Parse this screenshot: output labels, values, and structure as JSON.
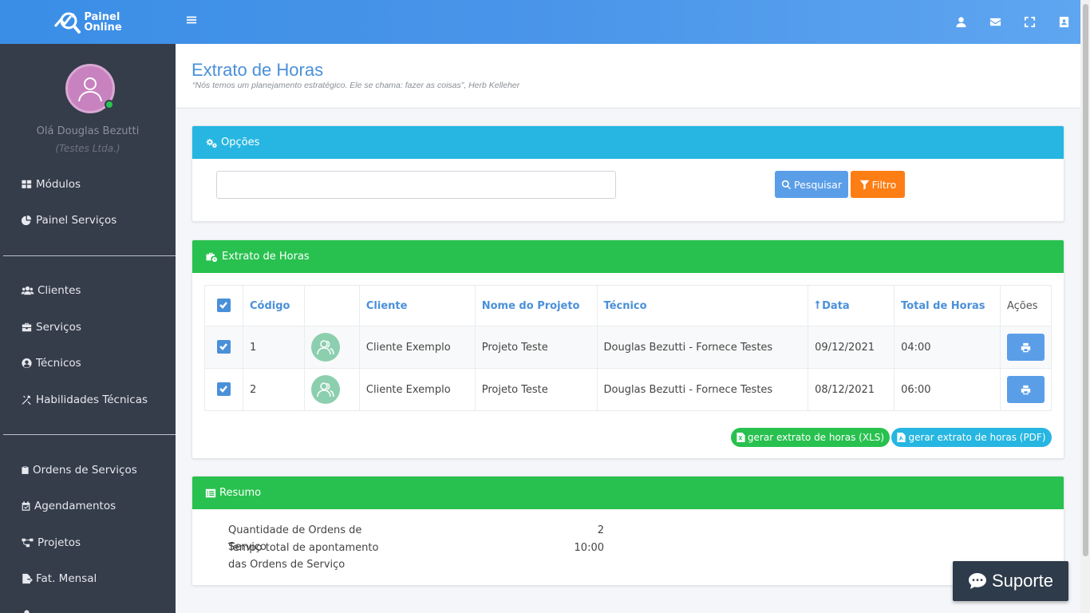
{
  "app": {
    "logo_line1": "Painel",
    "logo_line2": "Online"
  },
  "colors": {
    "topbar": "#4a95ea",
    "sidebar": "#353c4a",
    "info": "#26b6e1",
    "success": "#28c14f",
    "primary": "#5b9ee8",
    "warning": "#fd7e14"
  },
  "topbar": {
    "icons": [
      "user-icon",
      "envelope-icon",
      "fullscreen-icon",
      "contact-book-icon"
    ]
  },
  "sidebar": {
    "greeting": "Olá Douglas Bezutti",
    "company": "(Testes Ltda.)",
    "status": "online",
    "items": [
      {
        "label": "Módulos",
        "icon": "grid-icon"
      },
      {
        "label": "Painel Serviços",
        "icon": "pie-chart-icon"
      },
      {
        "label": "Clientes",
        "icon": "users-icon"
      },
      {
        "label": "Serviços",
        "icon": "briefcase-icon"
      },
      {
        "label": "Técnicos",
        "icon": "user-circle-icon"
      },
      {
        "label": "Habilidades Técnicas",
        "icon": "tools-icon"
      },
      {
        "label": "Ordens de Serviços",
        "icon": "clipboard-icon"
      },
      {
        "label": "Agendamentos",
        "icon": "calendar-check-icon"
      },
      {
        "label": "Projetos",
        "icon": "project-diagram-icon"
      },
      {
        "label": "Fat. Mensal",
        "icon": "file-invoice-icon"
      }
    ]
  },
  "header": {
    "title": "Extrato de Horas",
    "quote": "“Nós temos um planejamento estratégico. Ele se chama: fazer as coisas”, Herb Kelleher"
  },
  "options": {
    "title": "Opções",
    "search_value": "",
    "search_button": "Pesquisar",
    "filter_button": "Filtro"
  },
  "statement": {
    "title": "Extrato de Horas",
    "columns": {
      "code": "Código",
      "client": "Cliente",
      "project": "Nome do Projeto",
      "technician": "Técnico",
      "date": "Data",
      "total": "Total de Horas",
      "actions": "Ações"
    },
    "rows": [
      {
        "checked": true,
        "code": "1",
        "client": "Cliente Exemplo",
        "project": "Projeto Teste",
        "technician": "Douglas Bezutti - Fornece Testes",
        "date": "09/12/2021",
        "total": "04:00"
      },
      {
        "checked": true,
        "code": "2",
        "client": "Cliente Exemplo",
        "project": "Projeto Teste",
        "technician": "Douglas Bezutti - Fornece Testes",
        "date": "08/12/2021",
        "total": "06:00"
      }
    ],
    "xls_button": "gerar extrato de horas (XLS)",
    "pdf_button": "gerar extrato de horas (PDF)"
  },
  "summary": {
    "title": "Resumo",
    "items": [
      {
        "label": "Quantidade de Ordens de Serviço",
        "value": "2"
      },
      {
        "label": "Tempo total de apontamento das Ordens de Serviço",
        "value": "10:00"
      }
    ]
  },
  "support": {
    "label": "Suporte"
  }
}
